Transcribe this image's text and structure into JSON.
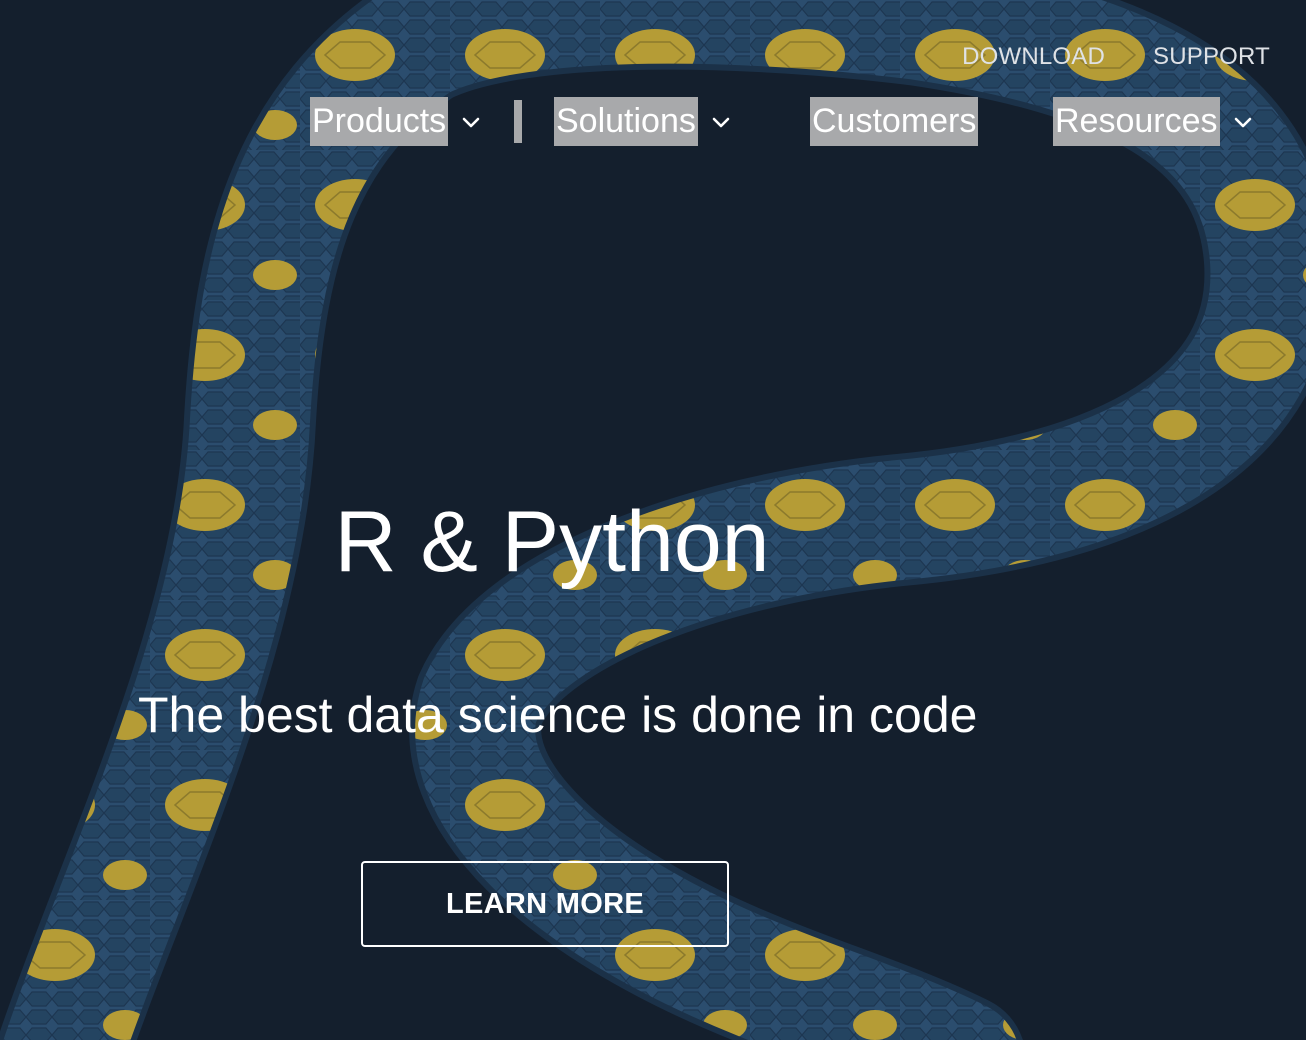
{
  "utility_nav": {
    "download": "DOWNLOAD",
    "support": "SUPPORT"
  },
  "main_nav": {
    "items": [
      {
        "label": "Products",
        "has_dropdown": true
      },
      {
        "label": "Solutions",
        "has_dropdown": true
      },
      {
        "label": "Customers",
        "has_dropdown": false
      },
      {
        "label": "Resources",
        "has_dropdown": true
      }
    ]
  },
  "hero": {
    "title": "R & Python",
    "subtitle": "The best data science is done in code",
    "cta_label": "LEARN MORE"
  },
  "colors": {
    "background": "#141f2d",
    "snake_blue": "#2a4a6b",
    "snake_yellow": "#b9a037",
    "nav_highlight": "#a8a9ab",
    "text": "#ffffff"
  },
  "icons": {
    "dropdown": "chevron-down-icon"
  }
}
